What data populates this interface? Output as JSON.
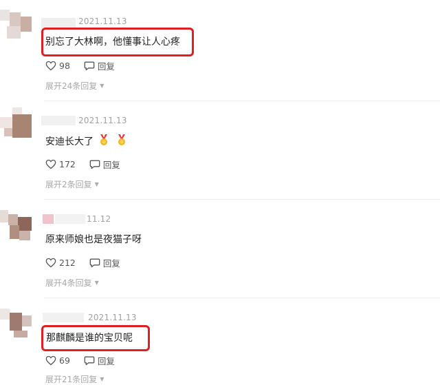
{
  "comments": [
    {
      "date": "2021.11.13",
      "text": "别忘了大林啊，他懂事让人心疼",
      "likes": "98",
      "reply_label": "回复",
      "expand_label": "展开24条回复"
    },
    {
      "date": "2021.11.13",
      "text": "安迪长大了",
      "likes": "172",
      "reply_label": "回复",
      "expand_label": "展开2条回复"
    },
    {
      "date": "11.12",
      "text": "原来师娘也是夜猫子呀",
      "likes": "212",
      "reply_label": "回复",
      "expand_label": "展开4条回复"
    },
    {
      "date": "2021.11.13",
      "text": "那麒麟是谁的宝贝呢",
      "likes": "69",
      "reply_label": "回复",
      "expand_label": "展开21条回复"
    }
  ],
  "icons": {
    "like": "heart-outline-icon",
    "reply": "speech-bubble-icon",
    "medal": "medal-icon",
    "caret": "caret-down-icon"
  },
  "colors": {
    "highlight": "#e02020",
    "meta": "#a0a0a0"
  }
}
